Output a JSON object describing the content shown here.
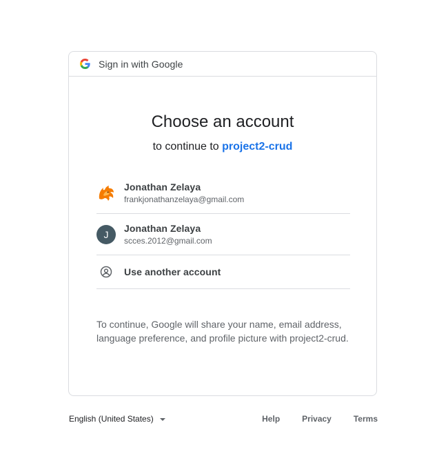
{
  "header": {
    "title": "Sign in with Google",
    "icon": "google-g-logo"
  },
  "main": {
    "title": "Choose an account",
    "subtitle_prefix": "to continue to",
    "app_name": "project2-crud",
    "accounts": [
      {
        "name": "Jonathan Zelaya",
        "email": "frankjonathanzelaya@gmail.com",
        "avatar": "flame-dragon-avatar"
      },
      {
        "name": "Jonathan Zelaya",
        "email": "scces.2012@gmail.com",
        "avatar_letter": "J",
        "avatar_color": "#455a64"
      }
    ],
    "use_another": "Use another account",
    "disclaimer": "To continue, Google will share your name, email address, language preference, and profile picture with project2-crud."
  },
  "footer": {
    "language": "English (United States)",
    "links": [
      "Help",
      "Privacy",
      "Terms"
    ]
  },
  "colors": {
    "accent": "#1a73e8",
    "border": "#dadce0",
    "text_secondary": "#5f6368"
  }
}
